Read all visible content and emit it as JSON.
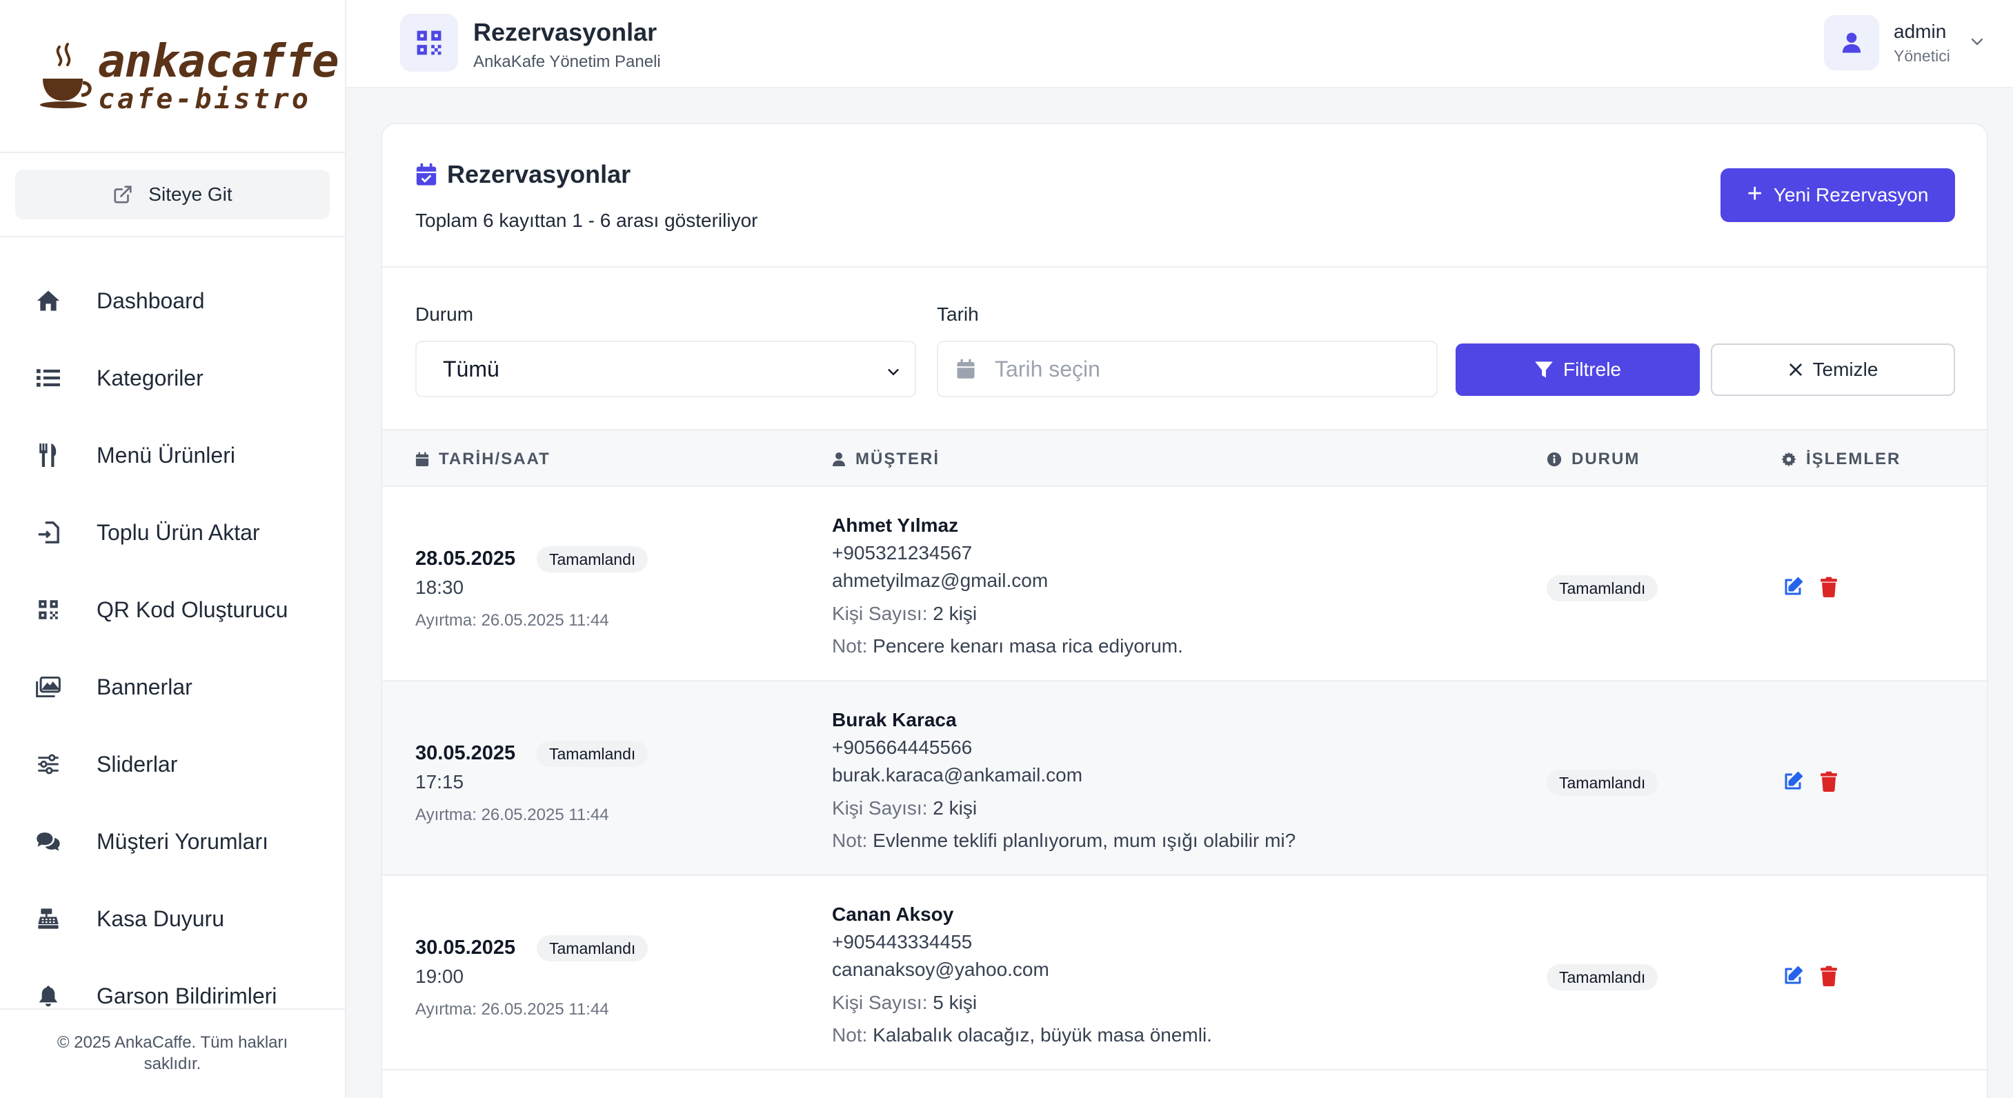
{
  "sidebar": {
    "logo_name": "ankacaffe",
    "logo_sub": "cafe-bistro",
    "site_button": "Siteye Git",
    "items": [
      {
        "label": "Dashboard",
        "icon": "home-icon"
      },
      {
        "label": "Kategoriler",
        "icon": "list-icon"
      },
      {
        "label": "Menü Ürünleri",
        "icon": "utensils-icon"
      },
      {
        "label": "Toplu Ürün Aktar",
        "icon": "file-import-icon"
      },
      {
        "label": "QR Kod Oluşturucu",
        "icon": "qrcode-icon"
      },
      {
        "label": "Bannerlar",
        "icon": "images-icon"
      },
      {
        "label": "Sliderlar",
        "icon": "sliders-icon"
      },
      {
        "label": "Müşteri Yorumları",
        "icon": "comments-icon"
      },
      {
        "label": "Kasa Duyuru",
        "icon": "cash-register-icon"
      },
      {
        "label": "Garson Bildirimleri",
        "icon": "bell-icon"
      }
    ],
    "footer": "© 2025 AnkaCaffe. Tüm hakları saklıdır."
  },
  "header": {
    "title": "Rezervasyonlar",
    "subtitle": "AnkaKafe Yönetim Paneli",
    "user_name": "admin",
    "user_role": "Yönetici"
  },
  "card": {
    "title": "Rezervasyonlar",
    "count_prefix": "Toplam ",
    "total": "6",
    "count_mid": " kayıttan ",
    "range_start": "1",
    "range_sep": " - ",
    "range_end": "6",
    "count_suffix": " arası gösteriliyor",
    "new_button": "Yeni Rezervasyon"
  },
  "filters": {
    "status_label": "Durum",
    "status_value": "Tümü",
    "date_label": "Tarih",
    "date_placeholder": "Tarih seçin",
    "filter_button": "Filtrele",
    "clear_button": "Temizle"
  },
  "table": {
    "headers": {
      "datetime": "TARİH/SAAT",
      "customer": "MÜŞTERİ",
      "status": "DURUM",
      "actions": "İŞLEMLER"
    },
    "people_label": "Kişi Sayısı:",
    "note_label": "Not:",
    "rows": [
      {
        "date": "28.05.2025",
        "time": "18:30",
        "reserved": "Ayırtma: 26.05.2025 11:44",
        "status": "Tamamlandı",
        "name": "Ahmet Yılmaz",
        "phone": "+905321234567",
        "email": "ahmetyilmaz@gmail.com",
        "people": "2 kişi",
        "note": "Pencere kenarı masa rica ediyorum."
      },
      {
        "date": "30.05.2025",
        "time": "17:15",
        "reserved": "Ayırtma: 26.05.2025 11:44",
        "status": "Tamamlandı",
        "name": "Burak Karaca",
        "phone": "+905664445566",
        "email": "burak.karaca@ankamail.com",
        "people": "2 kişi",
        "note": "Evlenme teklifi planlıyorum, mum ışığı olabilir mi?"
      },
      {
        "date": "30.05.2025",
        "time": "19:00",
        "reserved": "Ayırtma: 26.05.2025 11:44",
        "status": "Tamamlandı",
        "name": "Canan Aksoy",
        "phone": "+905443334455",
        "email": "canan​aksoy@yahoo.com",
        "people": "5 kişi",
        "note": "Kalabalık olacağız, büyük masa önemli."
      }
    ]
  },
  "colors": {
    "accent": "#4f46e5",
    "danger": "#dc2626",
    "edit": "#2563eb",
    "logo_brown": "#5a3318"
  }
}
